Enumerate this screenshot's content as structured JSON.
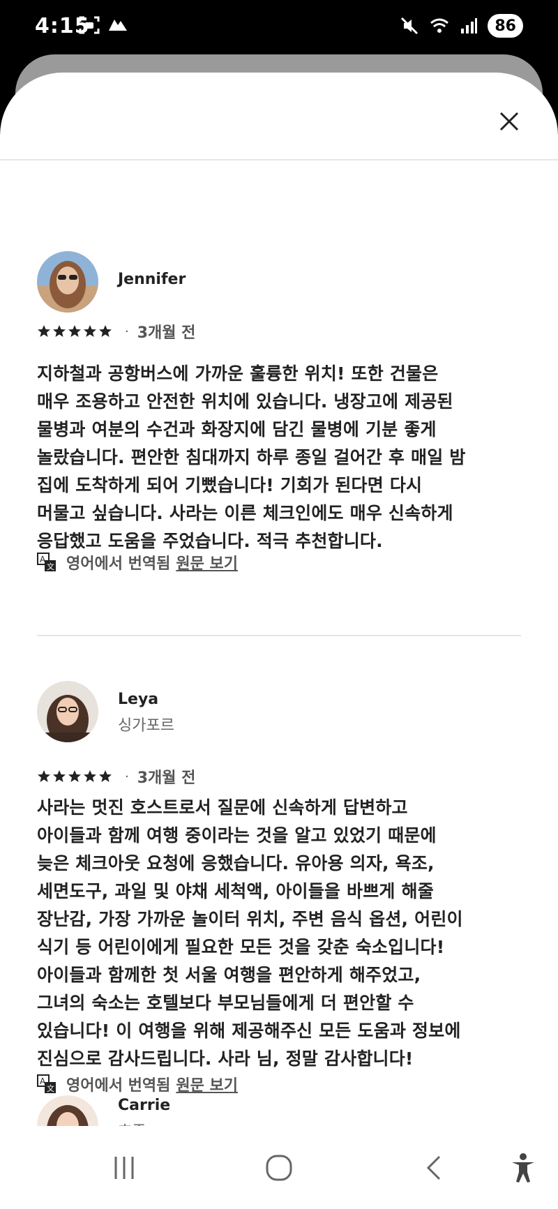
{
  "status_bar": {
    "time": "4:15",
    "battery": "86"
  },
  "reviews": [
    {
      "name": "Jennifer",
      "location": "",
      "rating": 5,
      "date": "3개월 전",
      "text_lines": [
        "지하철과 공항버스에 가까운 훌륭한 위치! 또한 건물은",
        "매우 조용하고 안전한 위치에 있습니다. 냉장고에 제공된",
        "물병과 여분의 수건과 화장지에 담긴 물병에 기분 좋게",
        "놀랐습니다. 편안한 침대까지 하루 종일 걸어간 후 매일 밤",
        "집에 도착하게 되어 기뻤습니다! 기회가 된다면 다시",
        "머물고 싶습니다. 사라는 이른 체크인에도 매우 신속하게",
        "응답했고 도움을 주었습니다. 적극 추천합니다."
      ],
      "translated_label": "영어에서 번역됨",
      "original_link": "원문 보기"
    },
    {
      "name": "Leya",
      "location": "싱가포르",
      "rating": 5,
      "date": "3개월 전",
      "text_lines": [
        "사라는 멋진 호스트로서 질문에 신속하게 답변하고",
        "아이들과 함께 여행 중이라는 것을 알고 있었기 때문에",
        "늦은 체크아웃 요청에 응했습니다. 유아용 의자, 욕조,",
        "세면도구, 과일 및 야채 세척액, 아이들을 바쁘게 해줄",
        "장난감, 가장 가까운 놀이터 위치, 주변 음식 옵션, 어린이",
        "식기 등 어린이에게 필요한 모든 것을 갖춘 숙소입니다!",
        "아이들과 함께한 첫 서울 여행을 편안하게 해주었고,",
        "그녀의 숙소는 호텔보다 부모님들에게 더 편안할 수",
        "있습니다! 이 여행을 위해 제공해주신 모든 도움과 정보에",
        "진심으로 감사드립니다. 사라 님, 정말 감사합니다!"
      ],
      "translated_label": "영어에서 번역됨",
      "original_link": "원문 보기"
    },
    {
      "name": "Carrie",
      "location": "호주"
    }
  ],
  "colors": {
    "text": "#222222",
    "muted": "#555555",
    "divider": "#e6e6e6"
  },
  "icons": [
    "close-icon",
    "star-icon",
    "translate-icon",
    "recent-apps-icon",
    "home-icon",
    "back-icon",
    "accessibility-icon"
  ]
}
